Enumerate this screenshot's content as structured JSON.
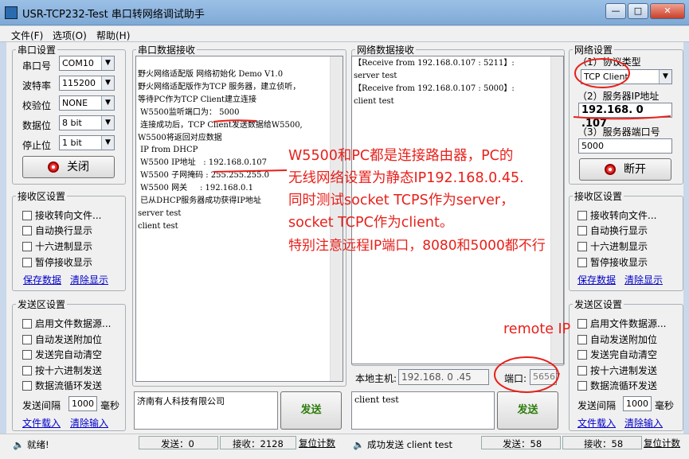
{
  "window": {
    "title": "USR-TCP232-Test 串口转网络调试助手",
    "min": "—",
    "max": "□",
    "close": "✕"
  },
  "menu": [
    "文件(F)",
    "选项(O)",
    "帮助(H)"
  ],
  "serial_settings": {
    "legend": "串口设置",
    "port_label": "串口号",
    "port_value": "COM10",
    "baud_label": "波特率",
    "baud_value": "115200",
    "parity_label": "校验位",
    "parity_value": "NONE",
    "data_label": "数据位",
    "data_value": "8 bit",
    "stop_label": "停止位",
    "stop_value": "1 bit",
    "close_button": "关闭"
  },
  "left_recv": {
    "legend": "接收区设置",
    "opt1": "接收转向文件...",
    "opt2": "自动换行显示",
    "opt3": "十六进制显示",
    "opt4": "暂停接收显示",
    "save": "保存数据",
    "clear": "清除显示"
  },
  "left_send": {
    "legend": "发送区设置",
    "opt1": "启用文件数据源...",
    "opt2": "自动发送附加位",
    "opt3": "发送完自动清空",
    "opt4": "按十六进制发送",
    "opt5": "数据流循环发送",
    "interval_label": "发送间隔",
    "interval_value": "1000",
    "interval_unit": "毫秒",
    "load": "文件载入",
    "clear": "清除输入"
  },
  "serial_recv": {
    "legend": "串口数据接收",
    "lines": [
      "野火网络适配版 网络初始化 Demo V1.0",
      "野火网络适配版作为TCP 服务器，建立侦听，",
      "等待PC作为TCP Client建立连接",
      " W5500监听端口为： 5000",
      " 连接成功后，TCP Client发送数据给W5500,",
      "W5500将返回对应数据",
      " IP from DHCP",
      " W5500 IP地址   : 192.168.0.107",
      " W5500 子网掩码 : 255.255.255.0",
      " W5500 网关     : 192.168.0.1",
      " 已从DHCP服务器成功获得IP地址",
      "server test",
      "client test"
    ]
  },
  "serial_send": {
    "text": "济南有人科技有限公司",
    "button": "发送"
  },
  "net_recv": {
    "legend": "网络数据接收",
    "lines": [
      "【Receive from 192.168.0.107 : 5211】:",
      "server test",
      "【Receive from 192.168.0.107 : 5000】:",
      "client test"
    ]
  },
  "net_local": {
    "host_label": "本地主机:",
    "host_value": "192.168. 0 .45",
    "port_label": "端口:",
    "port_value": "56567"
  },
  "net_send": {
    "text": "client test",
    "button": "发送"
  },
  "net_settings": {
    "legend": "网络设置",
    "proto_label": "（1）协议类型",
    "proto_value": "TCP Client",
    "ip_label": "（2）服务器IP地址",
    "ip_value": "192.168. 0 .107",
    "port_label": "（3）服务器端口号",
    "port_value": "5000",
    "disconnect": "断开"
  },
  "right_recv": {
    "legend": "接收区设置",
    "opt1": "接收转向文件...",
    "opt2": "自动换行显示",
    "opt3": "十六进制显示",
    "opt4": "暂停接收显示",
    "save": "保存数据",
    "clear": "清除显示"
  },
  "right_send": {
    "legend": "发送区设置",
    "opt1": "启用文件数据源...",
    "opt2": "自动发送附加位",
    "opt3": "发送完自动清空",
    "opt4": "按十六进制发送",
    "opt5": "数据流循环发送",
    "interval_label": "发送间隔",
    "interval_value": "1000",
    "interval_unit": "毫秒",
    "load": "文件载入",
    "clear": "清除输入"
  },
  "annotation": {
    "lines": [
      "W5500和PC都是连接路由器，PC的",
      "无线网络设置为静态IP192.168.0.45.",
      "同时测试socket TCPS作为server，",
      "socket TCPC作为client。",
      "特别注意远程IP端口，8080和5000都不行"
    ],
    "remote": "remote IP"
  },
  "status": {
    "ready": "就绪!",
    "send1": "发送：0",
    "recv1": "接收：2128",
    "reset1": "复位计数",
    "msg": "成功发送 client test",
    "send2": "发送：58",
    "recv2": "接收：58",
    "reset2": "复位计数"
  }
}
